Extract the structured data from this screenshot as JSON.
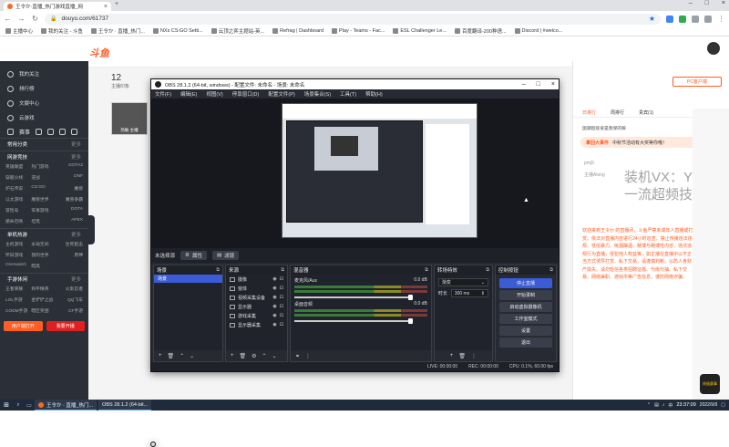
{
  "browser": {
    "tab_title": "王令か·直播_热门游戏直播_网",
    "url": "douyu.com/61737",
    "bookmarks": [
      "主播中心",
      "我的关注 - 斗鱼",
      "王令か · 直播_热门...",
      "NXs CS:GO Setti...",
      "云顶之弈主题站-英...",
      "Refrag | Dashboard",
      "Play - Teams - Fac...",
      "ESL Challenger Le...",
      "百度翻译-200种语...",
      "Discord | #welco..."
    ]
  },
  "douyu": {
    "logo": "斗鱼",
    "follow_count": "12",
    "follow_label": "主播印象",
    "streamer_tag": "热敏   主播",
    "sidebar": {
      "items": [
        "我的关注",
        "排行榜",
        "文娱中心",
        "云游戏",
        "赛事"
      ],
      "sections": [
        {
          "title": "常用分类",
          "more": "更多"
        },
        {
          "title": "网游竞技",
          "more": "更多",
          "items": [
            "英雄联盟",
            "热门游戏",
            "DOTA2",
            "穿越火线",
            "逆战",
            "DNF",
            "炉石传说",
            "CS:GO",
            "魔兽",
            "以太游戏",
            "魔兽世界",
            "魔兽争霸",
            "冒险岛",
            "军事游戏",
            "DOTA",
            "使命召唤",
            "坦克",
            "APEX"
          ]
        },
        {
          "title": "单机热游",
          "more": "更多",
          "items": [
            "主机游戏",
            "永劫无间",
            "生死狙击",
            "怀旧游戏",
            "我的世界",
            "原神",
            "Overwatch",
            "暗黑"
          ]
        },
        {
          "title": "手游休闲",
          "more": "更多",
          "items": [
            "王者荣耀",
            "和平精英",
            "火影忍者",
            "LOL手游",
            "金铲铲之战",
            "QQ飞车",
            "CODM手游",
            "暗区突围",
            "CF手游"
          ]
        }
      ],
      "btn_open": "用户端打开",
      "btn_live": "我要开播"
    },
    "chat": {
      "pc_btn": "PC客户端",
      "tabs": [
        "日排行",
        "周排行",
        "贵宾(1)"
      ],
      "promo": "国潮超级爱是我保的嘛",
      "event_label": "拿回大事件",
      "event_text": "中秋节活动有大奖等你哦！",
      "user1": "pmj9",
      "user2": "主播Along",
      "watermark_1": "装机VX：Yuk",
      "watermark_2": "一流超频技术",
      "notice": "欢迎来到王令か 的直播间，斗鱼严禁未成年人直播或打赏。依法对直播内容进行24小时巡查，禁止传播违法违规、低俗暴力、吸烟酗酒、赌博与赌博性内容、违法违规行为直播，侵犯他人权益等，如主播在直播中以不正当方式诱导打赏、私下交易，请谨慎判断，以防人身财产损失。请勿轻信各类招聘征婚、代练代抽、私下交易、网络兼职、游戏币等广告信息，谨防网络诈骗。"
    },
    "badge": "终极赛事"
  },
  "obs": {
    "title": "OBS 28.1.2 (64-bit, windows) - 配置文件: 未命名 - 场景: 未命名",
    "menu": [
      "文件(F)",
      "编辑(E)",
      "视图(V)",
      "停靠窗口(D)",
      "配置文件(P)",
      "场景集合(S)",
      "工具(T)",
      "帮助(H)"
    ],
    "no_source": "未选择源",
    "btn_properties": "属性",
    "btn_filters": "滤镜",
    "docks": {
      "scenes": {
        "title": "场景",
        "items": [
          "场景"
        ]
      },
      "sources": {
        "title": "来源",
        "items": [
          "摄像",
          "窗体",
          "视频采集设备",
          "显示器",
          "游戏采集",
          "显示器采集"
        ]
      },
      "mixer": {
        "title": "混音器",
        "tracks": [
          {
            "name": "麦克风/Aux",
            "db": "0.0 dB"
          },
          {
            "name": "桌面音频",
            "db": "0.0 dB"
          }
        ]
      },
      "transitions": {
        "title": "转场特效",
        "type": "渐变",
        "duration_label": "时长",
        "duration": "300 ms"
      },
      "controls": {
        "title": "控制按钮",
        "buttons": [
          "停止直播",
          "开始录制",
          "启动虚拟摄像机",
          "工作室模式",
          "设置",
          "退出"
        ]
      }
    },
    "status": {
      "live": "LIVE: 00:00:00",
      "rec": "REC: 00:00:00",
      "cpu": "CPU: 0.1%, 60.00 fps"
    }
  },
  "taskbar": {
    "apps": [
      "王令か · 直播_热门...",
      "OBS 28.1.2 (64-bit..."
    ],
    "lang": "中",
    "time": "23:37:09",
    "date": "2022/9/9"
  }
}
